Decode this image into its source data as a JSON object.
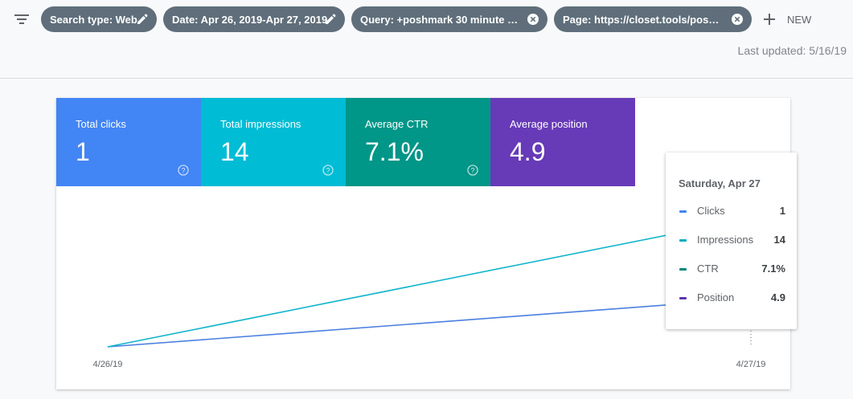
{
  "filters": [
    {
      "label": "Search type: Web",
      "action": "edit"
    },
    {
      "label": "Date: Apr 26, 2019-Apr 27, 2019",
      "action": "edit"
    },
    {
      "label": "Query: +poshmark 30 minute me...",
      "action": "remove"
    },
    {
      "label": "Page: https://closet.tools/poshm...",
      "action": "remove"
    }
  ],
  "new_button": "NEW",
  "last_updated": "Last updated: 5/16/19",
  "metrics": [
    {
      "label": "Total clicks",
      "value": "1",
      "color": "#4285f4"
    },
    {
      "label": "Total impressions",
      "value": "14",
      "color": "#00bcd4"
    },
    {
      "label": "Average CTR",
      "value": "7.1%",
      "color": "#009688"
    },
    {
      "label": "Average position",
      "value": "4.9",
      "color": "#673ab7"
    }
  ],
  "tooltip": {
    "title": "Saturday, Apr 27",
    "rows": [
      {
        "name": "Clicks",
        "value": "1",
        "color": "#4285f4"
      },
      {
        "name": "Impressions",
        "value": "14",
        "color": "#00acc1"
      },
      {
        "name": "CTR",
        "value": "7.1%",
        "color": "#00897b"
      },
      {
        "name": "Position",
        "value": "4.9",
        "color": "#5e35b1"
      }
    ]
  },
  "chart_data": {
    "type": "line",
    "x": [
      "4/26/19",
      "4/27/19"
    ],
    "series": [
      {
        "name": "Clicks",
        "values": [
          0,
          1
        ],
        "color": "#4a7fe0"
      },
      {
        "name": "Impressions",
        "values": [
          0,
          14
        ],
        "color": "#12b5cb"
      },
      {
        "name": "CTR",
        "values": [
          null,
          7.1
        ],
        "color": "#12938a"
      },
      {
        "name": "Position",
        "values": [
          null,
          4.9
        ],
        "color": "#6b3fb5"
      }
    ],
    "grid": false,
    "legend": "none"
  }
}
